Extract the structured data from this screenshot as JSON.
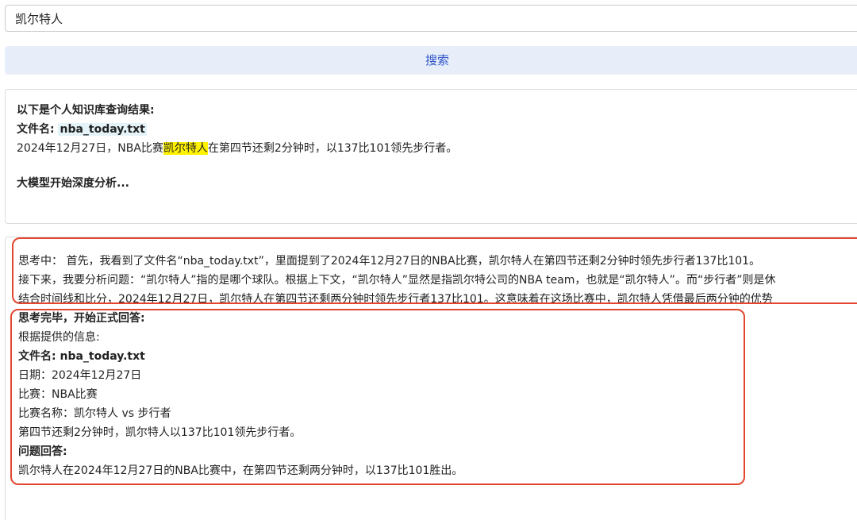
{
  "search": {
    "value": "凯尔特人"
  },
  "search_button": {
    "label": "搜索"
  },
  "kb_result": {
    "header": "以下是个人知识库查询结果:",
    "file_label": "文件名: ",
    "file_name": "nba_today.txt",
    "content_before": "2024年12月27日，NBA比赛",
    "content_highlight": "凯尔特人",
    "content_after": "在第四节还剩2分钟时，以137比101领先步行者。",
    "analysis_start": "大模型开始深度分析..."
  },
  "thinking": {
    "lines": [
      "思考中： 首先，我看到了文件名“nba_today.txt”，里面提到了2024年12月27日的NBA比赛，凯尔特人在第四节还剩2分钟时领先步行者137比101。",
      "接下来，我要分析问题：“凯尔特人”指的是哪个球队。根据上下文，“凯尔特人”显然是指凯尔特公司的NBA team，也就是“凯尔特人”。而“步行者”则是休",
      "结合时间线和比分，2024年12月27日，凯尔特人在第四节还剩两分钟时领先步行者137比101。这意味着在这场比赛中，凯尔特人凭借最后两分钟的优势"
    ]
  },
  "answer": {
    "header": "思考完毕，开始正式回答:",
    "intro": "根据提供的信息:",
    "file_line": "文件名: nba_today.txt",
    "date_line": "日期：2024年12月27日",
    "match_line": "比赛：NBA比赛",
    "match_name_line": "比赛名称：凯尔特人 vs 步行者",
    "score_line": "第四节还剩2分钟时，凯尔特人以137比101领先步行者。",
    "question_header": "问题回答:",
    "question_answer": "凯尔特人在2024年12月27日的NBA比赛中，在第四节还剩两分钟时，以137比101胜出。"
  }
}
